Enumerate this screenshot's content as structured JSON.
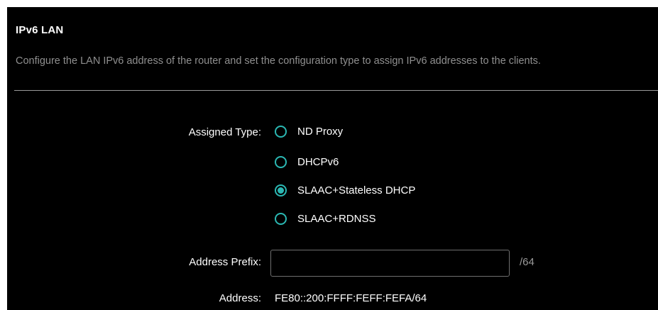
{
  "section": {
    "title": "IPv6 LAN",
    "description": "Configure the LAN IPv6 address of the router and set the configuration type to assign IPv6 addresses to the clients."
  },
  "assigned_type": {
    "label": "Assigned Type:",
    "options": [
      {
        "label": "ND Proxy",
        "selected": false
      },
      {
        "label": "DHCPv6",
        "selected": false
      },
      {
        "label": "SLAAC+Stateless DHCP",
        "selected": true
      },
      {
        "label": "SLAAC+RDNSS",
        "selected": false
      }
    ]
  },
  "address_prefix": {
    "label": "Address Prefix:",
    "value": "",
    "suffix": "/64"
  },
  "address": {
    "label": "Address:",
    "value": "FE80::200:FFFF:FEFF:FEFA/64"
  },
  "colors": {
    "background": "#000000",
    "accent": "#2bb8b3",
    "muted_text": "#8f8f8f"
  }
}
